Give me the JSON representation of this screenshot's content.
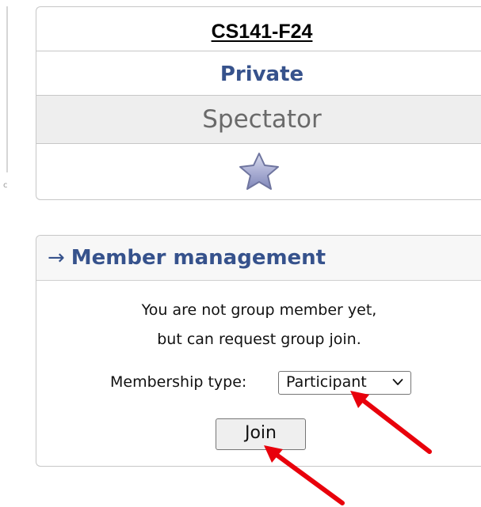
{
  "group": {
    "name": "CS141-F24",
    "visibility": "Private",
    "role": "Spectator",
    "favorite_icon": "star-icon"
  },
  "member_management": {
    "arrow_glyph": "→",
    "title": "Member management",
    "message_line1": "You are not group member yet,",
    "message_line2": "but can request group join.",
    "membership_type_label": "Membership type:",
    "membership_type_value": "Participant",
    "join_label": "Join"
  },
  "colors": {
    "heading_blue": "#36528c",
    "annotation_red": "#e8000b"
  }
}
